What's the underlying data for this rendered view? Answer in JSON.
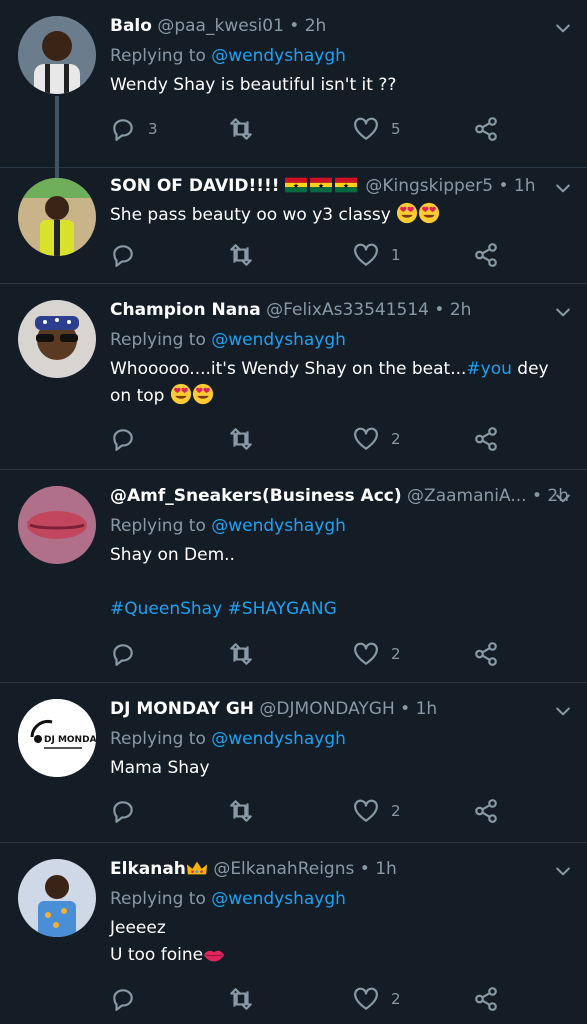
{
  "tweets": [
    {
      "name": "Balo",
      "handle": "@paa_kwesi01",
      "time": "2h",
      "reply_prefix": "Replying to",
      "reply_to": "@wendyshaygh",
      "text": "Wendy Shay is beautiful isn't it ??",
      "replies": "3",
      "retweets": "",
      "likes": "5"
    },
    {
      "name": "SON OF DAVID!!!!",
      "handle": "@Kingskipper5",
      "time": "1h",
      "text": "She pass beauty oo wo y3 classy",
      "replies": "",
      "retweets": "",
      "likes": "1"
    },
    {
      "name": "Champion Nana",
      "handle": "@FelixAs33541514",
      "time": "2h",
      "reply_prefix": "Replying to",
      "reply_to": "@wendyshaygh",
      "text_before": "Whooooo....it's Wendy Shay on the beat...",
      "hashtag": "#you",
      "text_after": " dey on top",
      "replies": "",
      "retweets": "",
      "likes": "2"
    },
    {
      "name": "@Amf_Sneakers(Business Acc)",
      "handle": "@ZaamaniA...",
      "time": "2h",
      "reply_prefix": "Replying to",
      "reply_to": "@wendyshaygh",
      "text": "Shay on Dem..",
      "hashtags": "#QueenShay #SHAYGANG",
      "replies": "",
      "retweets": "",
      "likes": "2"
    },
    {
      "name": "DJ MONDAY GH",
      "handle": "@DJMONDAYGH",
      "time": "1h",
      "reply_prefix": "Replying to",
      "reply_to": "@wendyshaygh",
      "text": "Mama Shay",
      "avatar_text": "DJ MONDAY",
      "replies": "",
      "retweets": "",
      "likes": "2"
    },
    {
      "name": "Elkanah",
      "handle": "@ElkanahReigns",
      "time": "1h",
      "reply_prefix": "Replying to",
      "reply_to": "@wendyshaygh",
      "text_line1": "Jeeeez",
      "text_line2": "U too foine",
      "replies": "",
      "retweets": "",
      "likes": "2"
    }
  ],
  "icons": {
    "reply": "reply-icon",
    "retweet": "retweet-icon",
    "like": "heart-icon",
    "share": "share-icon",
    "more": "chevron-down-icon"
  },
  "colors": {
    "background": "#141d26",
    "accent": "#1da1f2",
    "muted": "#8899a6",
    "divider": "#2a3744"
  }
}
